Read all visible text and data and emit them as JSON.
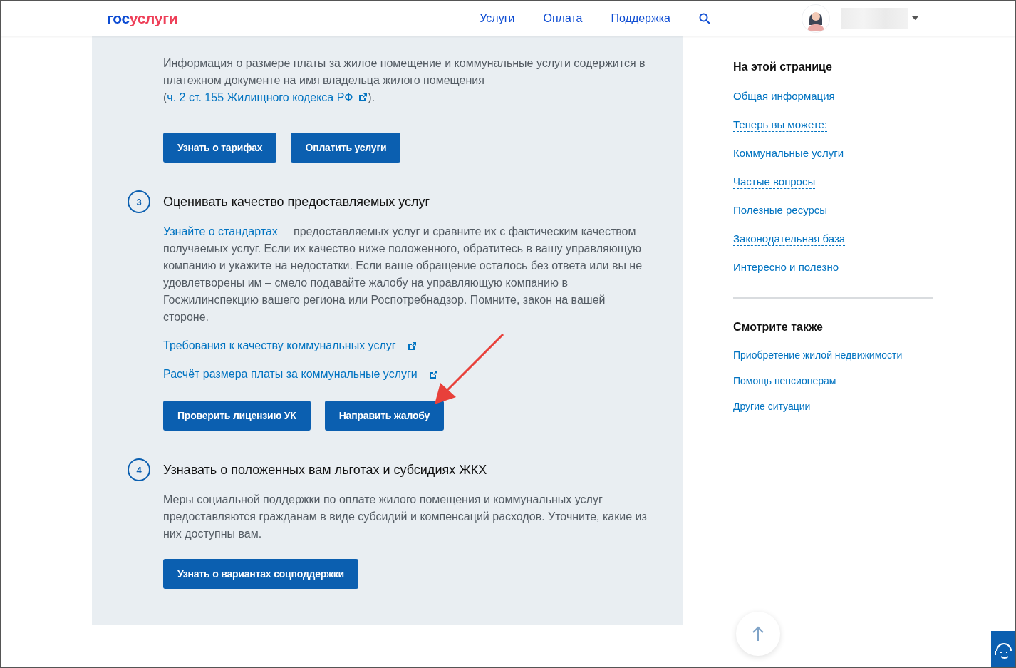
{
  "header": {
    "logo": [
      {
        "text": "гос",
        "color": "#0d4cd3"
      },
      {
        "text": "услуги",
        "color": "#ee3f58"
      }
    ],
    "nav": [
      "Услуги",
      "Оплата",
      "Поддержка"
    ]
  },
  "intro": {
    "paragraph": [
      {
        "kind": "text",
        "text": "Информация о размере платы за жилое помещение и коммунальные услуги содержится в платежном документе на имя владельца жилого помещения ("
      },
      {
        "kind": "link",
        "text": "ч. 2 ст. 155 Жилищного кодекса РФ",
        "external": true
      },
      {
        "kind": "text",
        "text": ")."
      }
    ],
    "buttons": [
      "Узнать о тарифах",
      "Оплатить услуги"
    ]
  },
  "steps": [
    {
      "number": "3",
      "title": "Оценивать качество предоставляемых услуг",
      "paragraph": [
        {
          "kind": "link",
          "text": "Узнайте о стандартах",
          "external": false
        },
        {
          "kind": "text",
          "text": "     предоставляемых услуг и сравните их с фактическим качеством получаемых услуг. Если их качество ниже положенного, обратитесь в вашу управляющую компанию и укажите на недостатки. Если ваше обращение осталось без ответа или вы не удовлетворены им – смело подавайте жалобу на управляющую компанию в Госжилинспекцию вашего региона или Роспотребнадзор. Помните, закон на вашей стороне."
        }
      ],
      "links": [
        {
          "text": "Требования к качеству коммунальных услуг",
          "external": true
        },
        {
          "text": "Расчёт размера платы за коммунальные услуги",
          "external": true
        }
      ],
      "buttons": [
        "Проверить лицензию УК",
        "Направить жалобу"
      ]
    },
    {
      "number": "4",
      "title": "Узнавать о положенных вам льготах и субсидиях ЖКХ",
      "paragraph": [
        {
          "kind": "text",
          "text": "Меры социальной поддержки по оплате жилого помещения и коммунальных услуг предоставляются гражданам в виде субсидий и компенсаций расходов. Уточните, какие из них доступны вам."
        }
      ],
      "buttons": [
        "Узнать о вариантах соцподдержки"
      ]
    }
  ],
  "sidebar": {
    "on_this_page": {
      "title": "На этой странице",
      "items": [
        "Общая информация",
        "Теперь вы можете:",
        "Коммунальные услуги",
        "Частые вопросы",
        "Полезные ресурсы",
        "Законодательная база",
        "Интересно и полезно"
      ]
    },
    "see_also": {
      "title": "Смотрите также",
      "items": [
        "Приобретение жилой недвижимости",
        "Помощь пенсионерам",
        "Другие ситуации"
      ]
    }
  }
}
